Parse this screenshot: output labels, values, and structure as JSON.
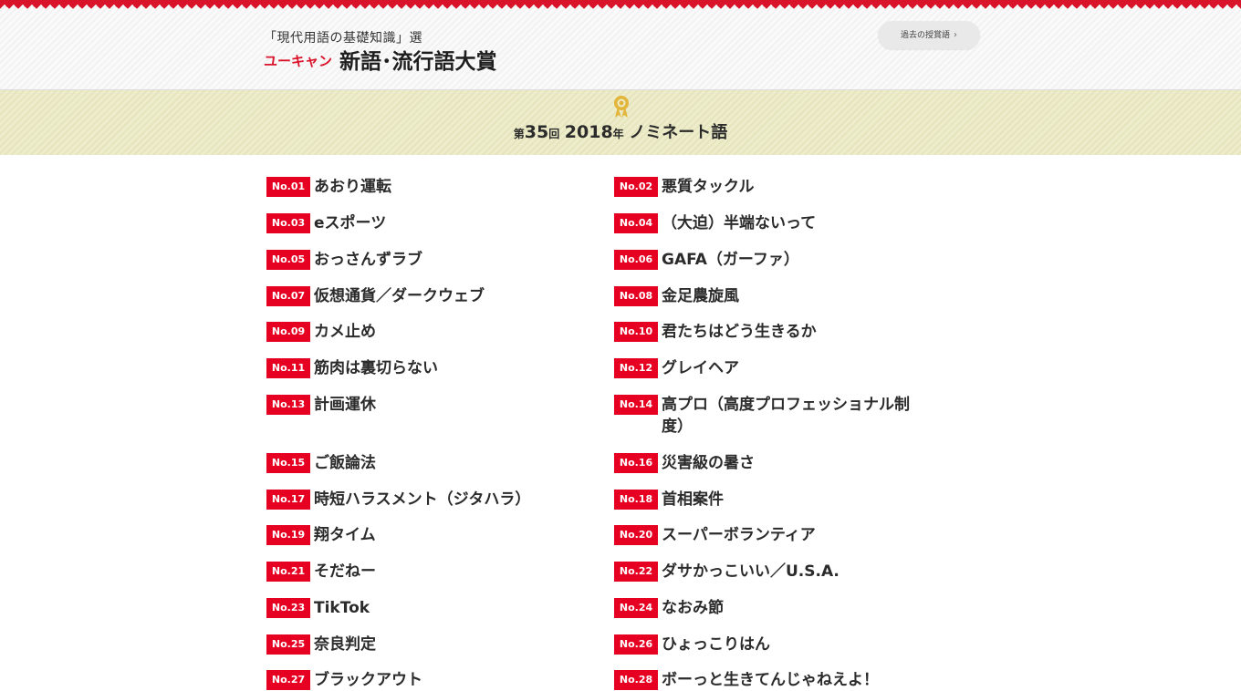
{
  "header": {
    "logo_sub": "「現代用語の基礎知識」選",
    "logo_brand": "ユーキャン",
    "logo_title": "新語･流行語大賞",
    "past_button": "過去の授賞語"
  },
  "band": {
    "prefix": "第",
    "edition": "35",
    "kai": "回",
    "year": "2018",
    "nen": "年",
    "title": "ノミネート語",
    "accent": "#e2b53b"
  },
  "nominees": [
    {
      "no": "No.01",
      "word": "あおり運転"
    },
    {
      "no": "No.02",
      "word": "悪質タックル"
    },
    {
      "no": "No.03",
      "word": "eスポーツ"
    },
    {
      "no": "No.04",
      "word": "（大迫）半端ないって"
    },
    {
      "no": "No.05",
      "word": "おっさんずラブ"
    },
    {
      "no": "No.06",
      "word": "GAFA（ガーファ）"
    },
    {
      "no": "No.07",
      "word": "仮想通貨／ダークウェブ"
    },
    {
      "no": "No.08",
      "word": "金足農旋風"
    },
    {
      "no": "No.09",
      "word": "カメ止め"
    },
    {
      "no": "No.10",
      "word": "君たちはどう生きるか"
    },
    {
      "no": "No.11",
      "word": "筋肉は裏切らない"
    },
    {
      "no": "No.12",
      "word": "グレイヘア"
    },
    {
      "no": "No.13",
      "word": "計画運休"
    },
    {
      "no": "No.14",
      "word": "高プロ（高度プロフェッショナル制度）"
    },
    {
      "no": "No.15",
      "word": "ご飯論法"
    },
    {
      "no": "No.16",
      "word": "災害級の暑さ"
    },
    {
      "no": "No.17",
      "word": "時短ハラスメント（ジタハラ）"
    },
    {
      "no": "No.18",
      "word": "首相案件"
    },
    {
      "no": "No.19",
      "word": "翔タイム"
    },
    {
      "no": "No.20",
      "word": "スーパーボランティア"
    },
    {
      "no": "No.21",
      "word": "そだねー"
    },
    {
      "no": "No.22",
      "word": "ダサかっこいい／U.S.A."
    },
    {
      "no": "No.23",
      "word": "TikTok"
    },
    {
      "no": "No.24",
      "word": "なおみ節"
    },
    {
      "no": "No.25",
      "word": "奈良判定"
    },
    {
      "no": "No.26",
      "word": "ひょっこりはん"
    },
    {
      "no": "No.27",
      "word": "ブラックアウト"
    },
    {
      "no": "No.28",
      "word": "ボーっと生きてんじゃねえよ！"
    }
  ],
  "colors": {
    "badge": "#e60021",
    "brand_red": "#d9132a"
  }
}
